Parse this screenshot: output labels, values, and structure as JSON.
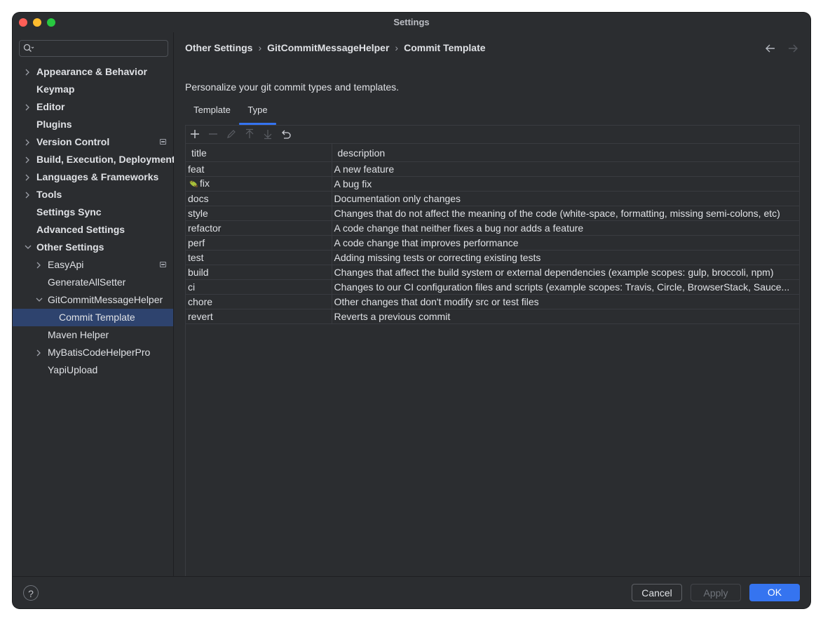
{
  "window": {
    "title": "Settings"
  },
  "sidebar": {
    "search_placeholder": "",
    "items": [
      {
        "label": "Appearance & Behavior",
        "level": 0,
        "bold": true,
        "expandable": true,
        "expanded": false
      },
      {
        "label": "Keymap",
        "level": 0,
        "bold": true,
        "expandable": false
      },
      {
        "label": "Editor",
        "level": 0,
        "bold": true,
        "expandable": true,
        "expanded": false
      },
      {
        "label": "Plugins",
        "level": 0,
        "bold": true,
        "expandable": false
      },
      {
        "label": "Version Control",
        "level": 0,
        "bold": true,
        "expandable": true,
        "expanded": false,
        "badge": true
      },
      {
        "label": "Build, Execution, Deployment",
        "level": 0,
        "bold": true,
        "expandable": true,
        "expanded": false
      },
      {
        "label": "Languages & Frameworks",
        "level": 0,
        "bold": true,
        "expandable": true,
        "expanded": false
      },
      {
        "label": "Tools",
        "level": 0,
        "bold": true,
        "expandable": true,
        "expanded": false
      },
      {
        "label": "Settings Sync",
        "level": 0,
        "bold": true,
        "expandable": false
      },
      {
        "label": "Advanced Settings",
        "level": 0,
        "bold": true,
        "expandable": false
      },
      {
        "label": "Other Settings",
        "level": 0,
        "bold": true,
        "expandable": true,
        "expanded": true
      },
      {
        "label": "EasyApi",
        "level": 1,
        "bold": false,
        "expandable": true,
        "expanded": false,
        "badge": true
      },
      {
        "label": "GenerateAllSetter",
        "level": 1,
        "bold": false,
        "expandable": false
      },
      {
        "label": "GitCommitMessageHelper",
        "level": 1,
        "bold": false,
        "expandable": true,
        "expanded": true
      },
      {
        "label": "Commit Template",
        "level": 2,
        "bold": false,
        "expandable": false,
        "selected": true
      },
      {
        "label": "Maven Helper",
        "level": 1,
        "bold": false,
        "expandable": false
      },
      {
        "label": "MyBatisCodeHelperPro",
        "level": 1,
        "bold": false,
        "expandable": true,
        "expanded": false
      },
      {
        "label": "YapiUpload",
        "level": 1,
        "bold": false,
        "expandable": false
      }
    ]
  },
  "breadcrumb": [
    "Other Settings",
    "GitCommitMessageHelper",
    "Commit Template"
  ],
  "main": {
    "description": "Personalize your git commit types and templates.",
    "tabs": [
      {
        "label": "Template",
        "active": false
      },
      {
        "label": "Type",
        "active": true
      }
    ]
  },
  "toolbar": {
    "buttons": [
      {
        "icon": "add-icon",
        "enabled": true
      },
      {
        "icon": "remove-icon",
        "enabled": false
      },
      {
        "icon": "edit-icon",
        "enabled": false
      },
      {
        "icon": "move-up-icon",
        "enabled": false
      },
      {
        "icon": "move-down-icon",
        "enabled": false
      },
      {
        "icon": "reset-icon",
        "enabled": true
      }
    ]
  },
  "table": {
    "columns": [
      "title",
      "description"
    ],
    "rows": [
      {
        "title": "feat",
        "description": "A new feature"
      },
      {
        "title": "fix",
        "icon": "bug-icon",
        "description": "A bug fix"
      },
      {
        "title": "docs",
        "description": "Documentation only changes"
      },
      {
        "title": "style",
        "description": "Changes that do not affect the meaning of the code (white-space, formatting, missing semi-colons, etc)"
      },
      {
        "title": "refactor",
        "description": "A code change that neither fixes a bug nor adds a feature"
      },
      {
        "title": "perf",
        "description": "A code change that improves performance"
      },
      {
        "title": "test",
        "description": "Adding missing tests or correcting existing tests"
      },
      {
        "title": "build",
        "description": "Changes that affect the build system or external dependencies (example scopes: gulp, broccoli, npm)"
      },
      {
        "title": "ci",
        "description": "Changes to our CI configuration files and scripts (example scopes: Travis, Circle, BrowserStack, Sauce..."
      },
      {
        "title": "chore",
        "description": "Other changes that don't modify src or test files"
      },
      {
        "title": "revert",
        "description": "Reverts a previous commit"
      }
    ]
  },
  "footer": {
    "help_label": "?",
    "cancel_label": "Cancel",
    "apply_label": "Apply",
    "ok_label": "OK"
  },
  "colors": {
    "accent": "#3574f0",
    "selection": "#2e436e",
    "background": "#2b2d30"
  }
}
